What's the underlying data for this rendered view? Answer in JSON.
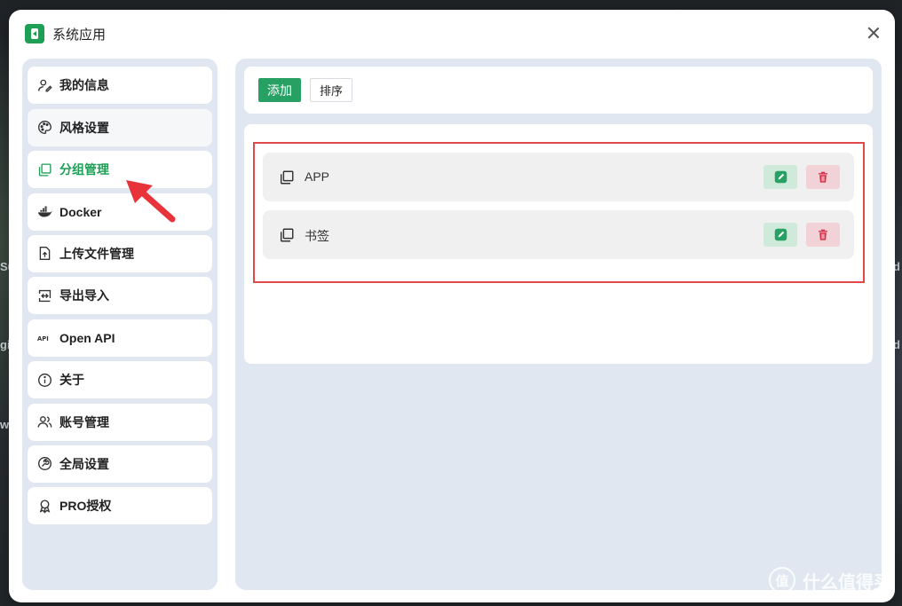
{
  "window": {
    "title": "系统应用"
  },
  "sidebar": {
    "items": [
      {
        "label": "我的信息",
        "icon": "user-edit-icon"
      },
      {
        "label": "风格设置",
        "icon": "palette-icon"
      },
      {
        "label": "分组管理",
        "icon": "copy-squares-icon",
        "active": true
      },
      {
        "label": "Docker",
        "icon": "docker-whale-icon"
      },
      {
        "label": "上传文件管理",
        "icon": "file-upload-icon"
      },
      {
        "label": "导出导入",
        "icon": "import-export-icon"
      },
      {
        "label": "Open API",
        "icon": "api-icon"
      },
      {
        "label": "关于",
        "icon": "info-icon"
      },
      {
        "label": "账号管理",
        "icon": "users-icon"
      },
      {
        "label": "全局设置",
        "icon": "tool-icon"
      },
      {
        "label": "PRO授权",
        "icon": "award-icon"
      }
    ]
  },
  "toolbar": {
    "add_label": "添加",
    "sort_label": "排序"
  },
  "groups": [
    {
      "label": "APP"
    },
    {
      "label": "书签"
    }
  ],
  "watermark": {
    "badge": "值",
    "text": "什么值得买"
  },
  "colors": {
    "accent": "#27a163",
    "active_text": "#1d9f55",
    "danger": "#d9304a",
    "annotation": "#e24a4a"
  }
}
